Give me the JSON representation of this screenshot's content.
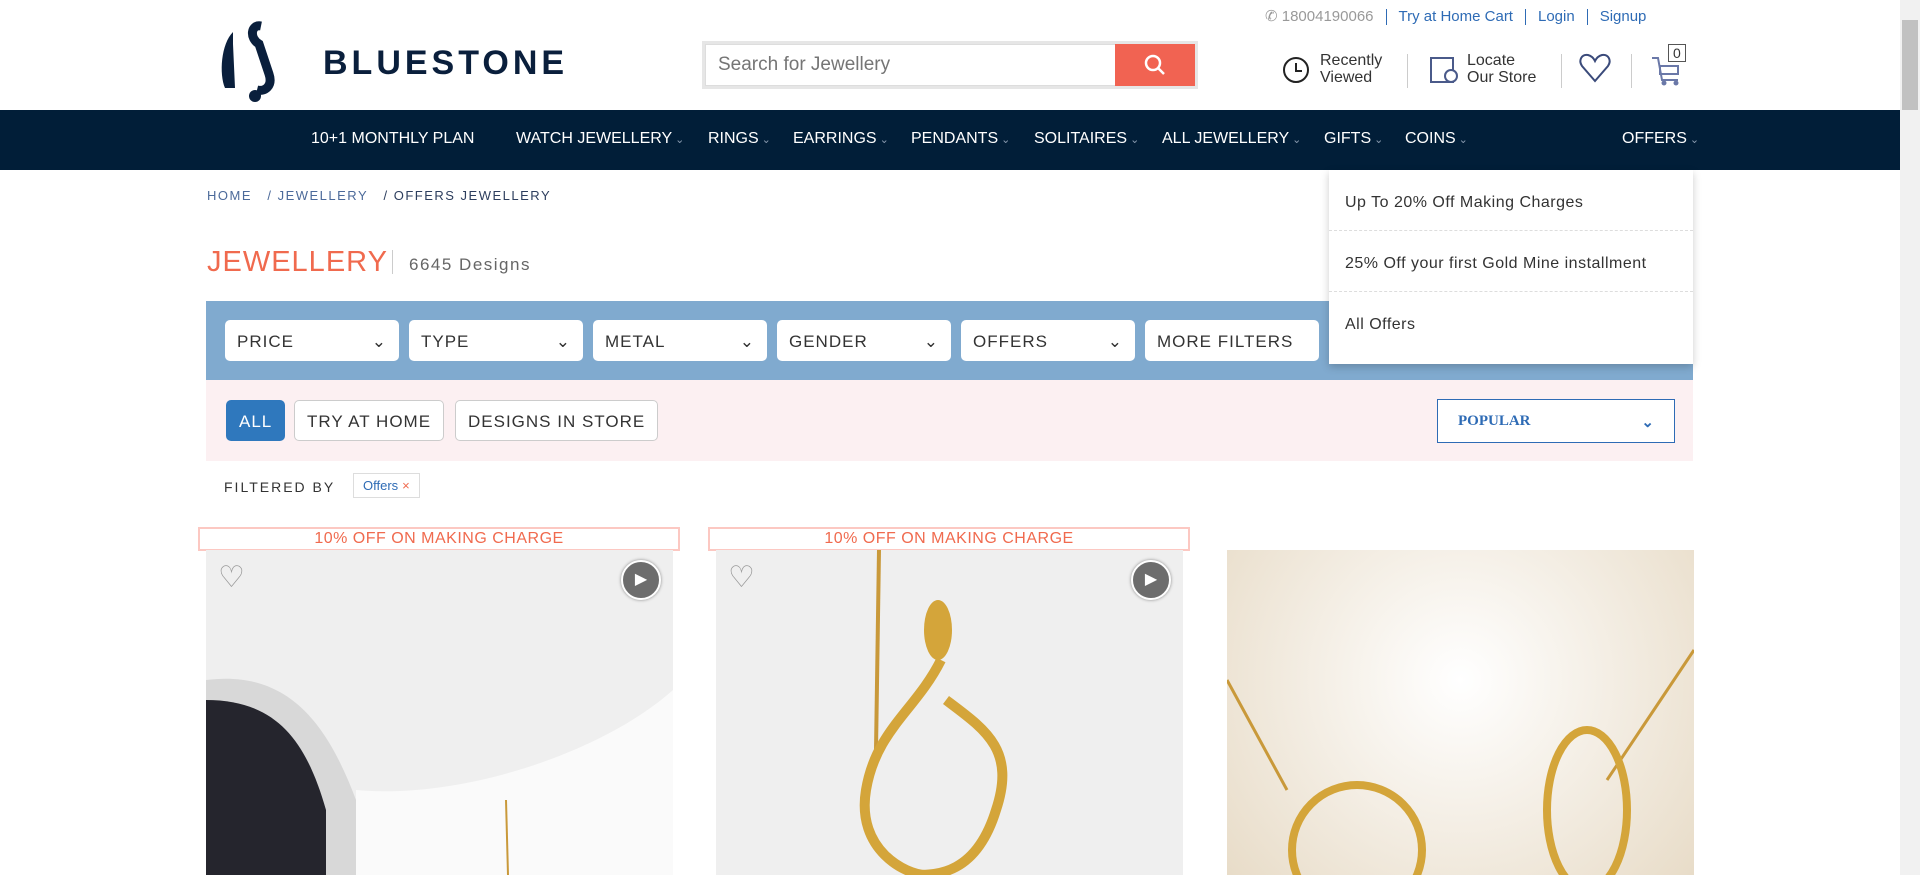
{
  "top_links": {
    "phone": "18004190066",
    "try_home": "Try at Home Cart",
    "login": "Login",
    "signup": "Signup"
  },
  "brand": "BLUESTONE",
  "search": {
    "placeholder": "Search for Jewellery"
  },
  "header_icons": {
    "recent_1": "Recently",
    "recent_2": "Viewed",
    "store_1": "Locate",
    "store_2": "Our Store",
    "cart_count": "0"
  },
  "nav": [
    "10+1 MONTHLY PLAN",
    "WATCH JEWELLERY",
    "RINGS",
    "EARRINGS",
    "PENDANTS",
    "SOLITAIRES",
    "ALL JEWELLERY",
    "GIFTS",
    "COINS",
    "OFFERS"
  ],
  "breadcrumb": {
    "home": "HOME",
    "jewellery": "/ JEWELLERY",
    "current": "/ OFFERS JEWELLERY"
  },
  "page": {
    "title": "JEWELLERY",
    "count": "6645 Designs"
  },
  "filters": [
    "PRICE",
    "TYPE",
    "METAL",
    "GENDER",
    "OFFERS",
    "MORE FILTERS"
  ],
  "tabs": [
    "ALL",
    "TRY AT HOME",
    "DESIGNS IN STORE"
  ],
  "sort": "POPULAR",
  "filtered_by": {
    "label": "FILTERED BY",
    "chip": "Offers"
  },
  "offers_dropdown": [
    "Up To 20% Off Making Charges",
    "25% Off your first Gold Mine installment",
    "All Offers"
  ],
  "products": [
    {
      "badge": "10% OFF ON MAKING CHARGE"
    },
    {
      "badge": "10% OFF ON MAKING CHARGE"
    },
    {}
  ],
  "colors": {
    "nav": "#011e38",
    "accent": "#f16352",
    "filter_bar": "#80aacf",
    "link": "#2e6bb5"
  }
}
